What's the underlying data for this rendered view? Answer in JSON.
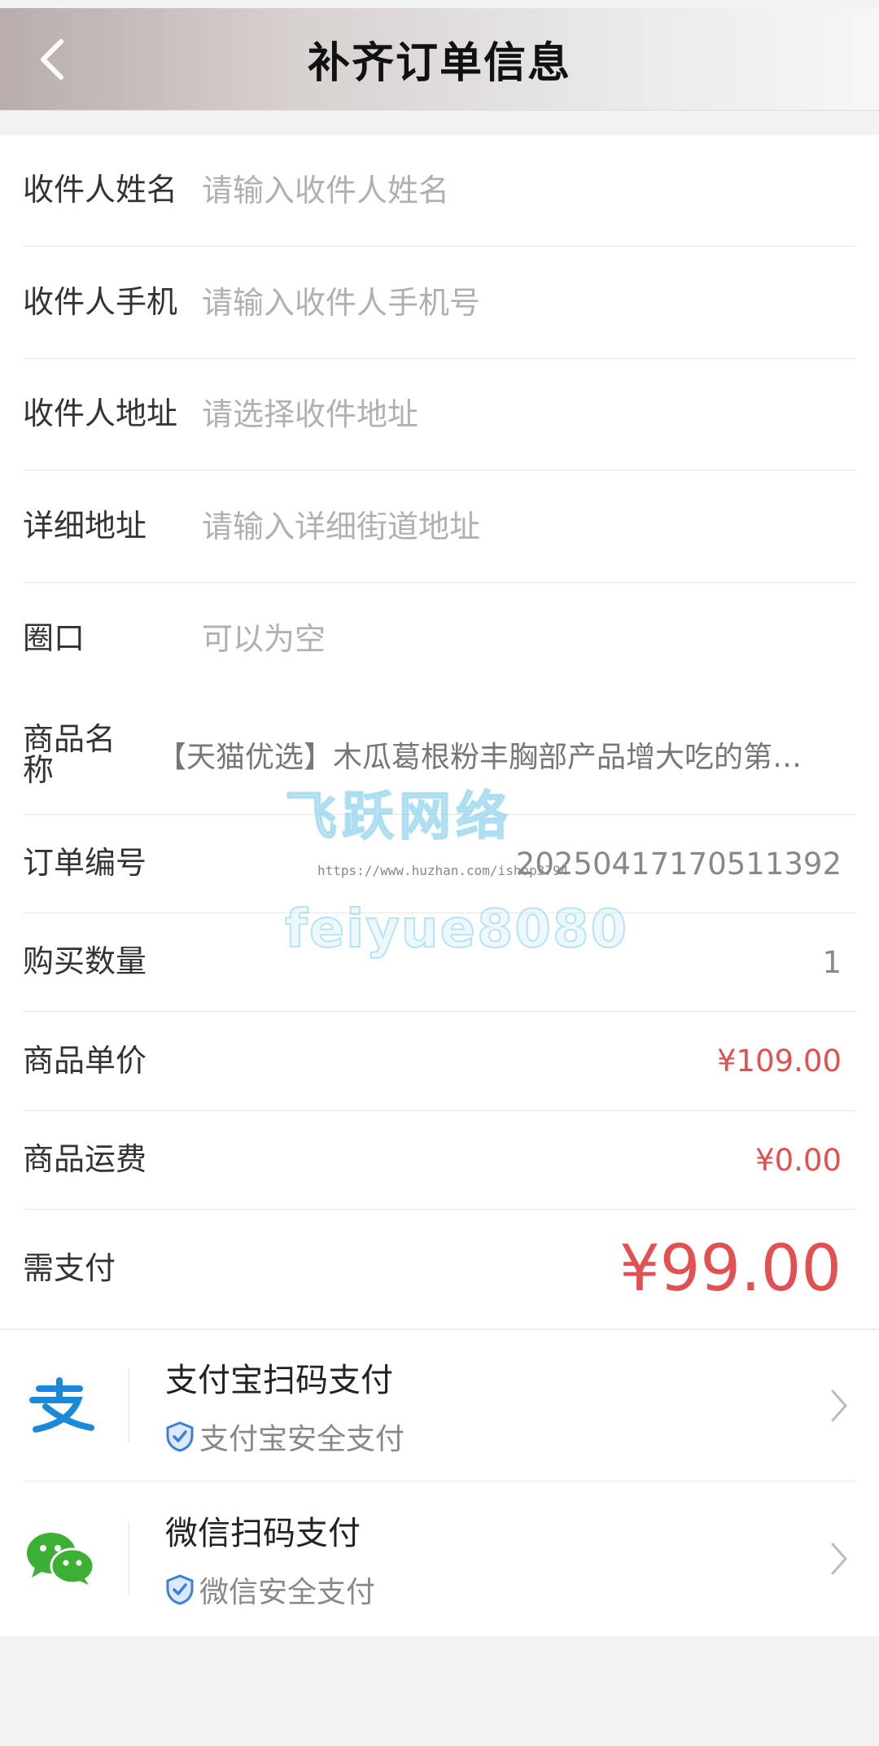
{
  "header": {
    "title": "补齐订单信息"
  },
  "form": {
    "name": {
      "label": "收件人姓名",
      "placeholder": "请输入收件人姓名"
    },
    "phone": {
      "label": "收件人手机",
      "placeholder": "请输入收件人手机号"
    },
    "address": {
      "label": "收件人地址",
      "placeholder": "请选择收件地址"
    },
    "detail": {
      "label": "详细地址",
      "placeholder": "请输入详细街道地址"
    },
    "circle": {
      "label": "圈口",
      "placeholder": "可以为空"
    }
  },
  "order": {
    "product_label": "商品名称",
    "product_name": "【天猫优选】木瓜葛根粉丰胸部产品增大吃的第…",
    "order_no_label": "订单编号",
    "order_no": "2025041717051139​2",
    "qty_label": "购买数量",
    "qty": "1",
    "price_label": "商品单价",
    "price": "¥109.00",
    "shipping_label": "商品运费",
    "shipping": "¥0.00",
    "pay_label": "需支付",
    "pay_amount": "¥99.00"
  },
  "payment": {
    "alipay": {
      "title": "支付宝扫码支付",
      "sub": "支付宝安全支付"
    },
    "wechat": {
      "title": "微信扫码支付",
      "sub": "微信安全支付"
    }
  },
  "watermark": {
    "brand_cn": "飞跃网络",
    "url": "https://www.huzhan.com/ishop3794",
    "id": "feiyue8080"
  },
  "colors": {
    "accent_red": "#e15151",
    "alipay_blue": "#1a8ad8",
    "wechat_green": "#3cb034"
  },
  "icons": [
    "chevron-left-icon",
    "alipay-icon",
    "wechat-icon",
    "shield-check-icon",
    "chevron-right-icon"
  ]
}
